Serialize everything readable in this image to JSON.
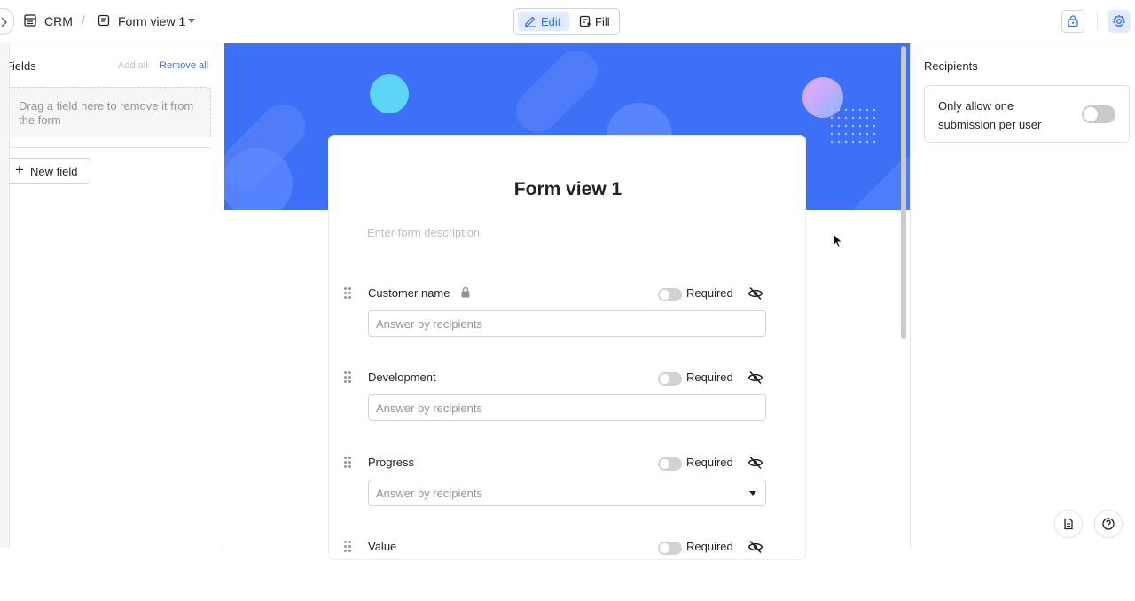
{
  "topbar": {
    "expand_icon": "chevron-right-icon",
    "app_icon": "table-icon",
    "app_name": "CRM",
    "separator": "/",
    "view_icon": "form-icon",
    "view_name": "Form view 1",
    "modes": {
      "edit_label": "Edit",
      "fill_label": "Fill",
      "active": "Edit"
    },
    "share_icon": "lock-share-icon",
    "settings_icon": "gear-icon"
  },
  "sidebar": {
    "title": "Fields",
    "add_all": "Add all",
    "remove_all": "Remove all",
    "dropzone_text": "Drag a field here to remove it from the form",
    "new_field_label": "New field"
  },
  "form": {
    "title": "Form view 1",
    "description_placeholder": "Enter form description",
    "required_label": "Required",
    "answer_placeholder": "Answer by recipients",
    "fields": [
      {
        "name": "Customer name",
        "locked": true,
        "required": false,
        "type": "text"
      },
      {
        "name": "Development",
        "locked": false,
        "required": false,
        "type": "text"
      },
      {
        "name": "Progress",
        "locked": false,
        "required": false,
        "type": "select"
      },
      {
        "name": "Value",
        "locked": false,
        "required": false,
        "type": "text"
      }
    ]
  },
  "recipients": {
    "title": "Recipients",
    "option_label": "Only allow one submission per user",
    "option_enabled": false
  },
  "bottom_buttons": {
    "doc_icon": "document-icon",
    "help_icon": "help-icon"
  },
  "colors": {
    "accent": "#3370ff",
    "banner": "#3e70f7",
    "border": "#d0d3d6"
  }
}
